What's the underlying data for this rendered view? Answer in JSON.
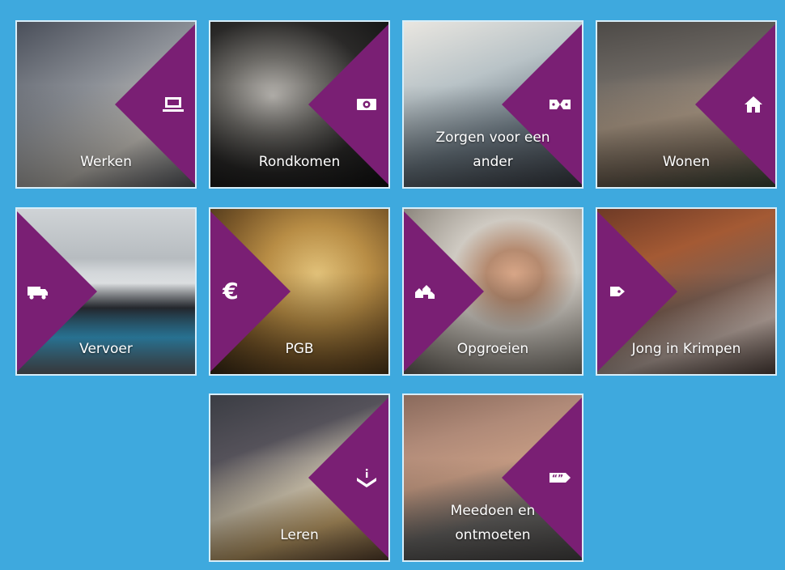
{
  "colors": {
    "background": "#3ea9de",
    "diamond": "#7a1f74",
    "tile_border": "#d8eef9"
  },
  "tiles": [
    {
      "label": "Werken",
      "icon": "computer-icon"
    },
    {
      "label": "Rondkomen",
      "icon": "banknote-icon"
    },
    {
      "label": "Zorgen voor een",
      "label2": "ander",
      "icon": "link-icon"
    },
    {
      "label": "Wonen",
      "icon": "house-icon"
    },
    {
      "label": "Vervoer",
      "icon": "truck-icon"
    },
    {
      "label": "PGB",
      "icon": "euro-icon",
      "glyph": "€"
    },
    {
      "label": "Opgroeien",
      "icon": "houses-icon"
    },
    {
      "label": "Jong in Krimpen",
      "icon": "tag-icon"
    },
    {
      "label": "Leren",
      "icon": "info-inbox-icon"
    },
    {
      "label": "Meedoen en",
      "label2": "ontmoeten",
      "icon": "quote-tag-icon"
    }
  ]
}
